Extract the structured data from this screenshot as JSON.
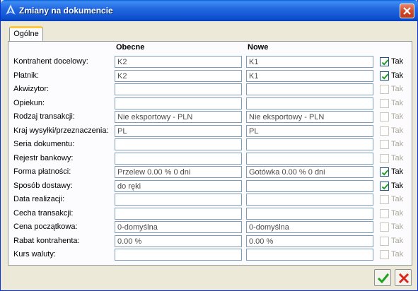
{
  "window": {
    "title": "Zmiany na dokumencie"
  },
  "tabs": [
    {
      "label": "Ogólne"
    }
  ],
  "columns": {
    "current": "Obecne",
    "new": "Nowe"
  },
  "rows": [
    {
      "label": "Kontrahent docelowy:",
      "current": "K2",
      "new": "K1",
      "checked": true,
      "enabled": true,
      "check_label": "Tak"
    },
    {
      "label": "Płatnik:",
      "current": "K2",
      "new": "K1",
      "checked": true,
      "enabled": true,
      "check_label": "Tak"
    },
    {
      "label": "Akwizytor:",
      "current": "",
      "new": "",
      "checked": false,
      "enabled": false,
      "check_label": "Tak"
    },
    {
      "label": "Opiekun:",
      "current": "",
      "new": "",
      "checked": false,
      "enabled": false,
      "check_label": "Tak"
    },
    {
      "label": "Rodzaj transakcji:",
      "current": "Nie eksportowy - PLN",
      "new": "Nie eksportowy - PLN",
      "checked": false,
      "enabled": false,
      "check_label": "Tak"
    },
    {
      "label": "Kraj wysyłki/przeznaczenia:",
      "current": "PL",
      "new": "PL",
      "checked": false,
      "enabled": false,
      "check_label": "Tak"
    },
    {
      "label": "Seria dokumentu:",
      "current": "",
      "new": "",
      "checked": false,
      "enabled": false,
      "check_label": "Tak"
    },
    {
      "label": "Rejestr bankowy:",
      "current": "",
      "new": "",
      "checked": false,
      "enabled": false,
      "check_label": "Tak"
    },
    {
      "label": "Forma płatności:",
      "current": "Przelew   0.00 % 0 dni",
      "new": "Gotówka   0.00 % 0 dni",
      "checked": true,
      "enabled": true,
      "check_label": "Tak"
    },
    {
      "label": "Sposób dostawy:",
      "current": "do ręki",
      "new": "",
      "checked": true,
      "enabled": true,
      "check_label": "Tak"
    },
    {
      "label": "Data realizacji:",
      "current": "",
      "new": "",
      "checked": false,
      "enabled": false,
      "check_label": "Tak"
    },
    {
      "label": "Cecha transakcji:",
      "current": "",
      "new": "",
      "checked": false,
      "enabled": false,
      "check_label": "Tak"
    },
    {
      "label": "Cena początkowa:",
      "current": "  0-domyślna",
      "new": "  0-domyślna",
      "checked": false,
      "enabled": false,
      "check_label": "Tak"
    },
    {
      "label": "Rabat kontrahenta:",
      "current": "  0.00 %",
      "new": "  0.00 %",
      "checked": false,
      "enabled": false,
      "check_label": "Tak"
    },
    {
      "label": "Kurs waluty:",
      "current": "",
      "new": "",
      "checked": false,
      "enabled": false,
      "check_label": "Tak"
    }
  ],
  "colors": {
    "titlebar": "#0B4FCE",
    "check": "#21A121",
    "cancel": "#D8261C"
  },
  "icons": {
    "app": "app-logo-icon",
    "close": "close-icon",
    "ok": "checkmark-icon",
    "cancel": "cross-icon"
  }
}
